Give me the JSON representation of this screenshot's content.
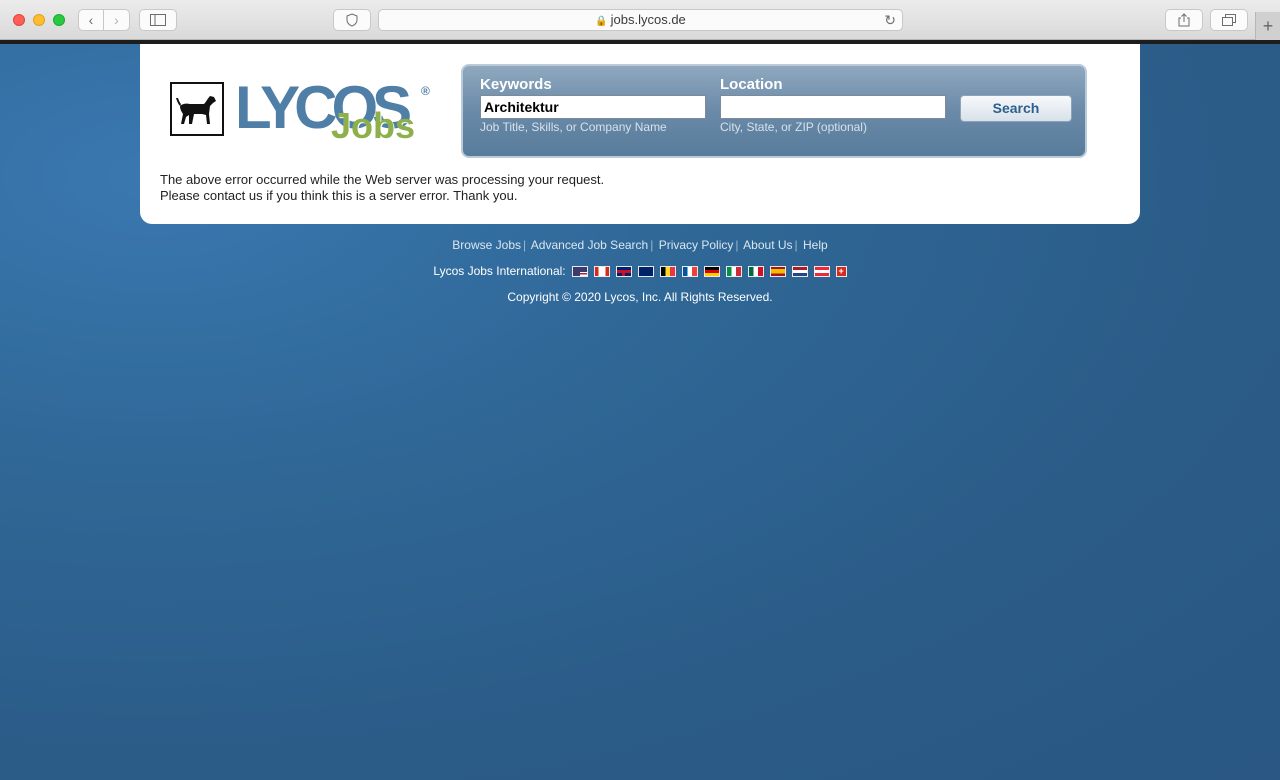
{
  "browser": {
    "url": "jobs.lycos.de"
  },
  "search": {
    "keywords_label": "Keywords",
    "keywords_value": "Architektur",
    "keywords_hint": "Job Title, Skills, or Company Name",
    "location_label": "Location",
    "location_value": "",
    "location_hint": "City, State, or ZIP (optional)",
    "button_label": "Search"
  },
  "error": {
    "line1": "The above error occurred while the Web server was processing your request.",
    "line2": "Please contact us if you think this is a server error. Thank you."
  },
  "footer": {
    "links": [
      "Browse Jobs",
      "Advanced Job Search",
      "Privacy Policy",
      "About Us",
      "Help"
    ],
    "international_label": "Lycos Jobs International:",
    "flags": [
      "us",
      "ca",
      "uk",
      "au",
      "be",
      "fr",
      "de",
      "it",
      "mx",
      "es",
      "nl",
      "at",
      "ch"
    ],
    "copyright": "Copyright © 2020 Lycos, Inc. All Rights Reserved."
  },
  "logo": {
    "wordmark": "LYCOS",
    "sub": "Jobs",
    "registered": "®"
  },
  "colors": {
    "page_bg": "#2c5d8a",
    "logo_blue": "#4f7ea6",
    "logo_green": "#8db04b"
  }
}
